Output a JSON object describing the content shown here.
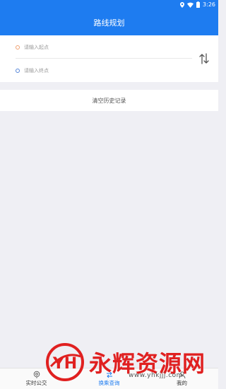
{
  "status_bar": {
    "time": "3:26"
  },
  "app_bar": {
    "title": "路线规划"
  },
  "route": {
    "start_placeholder": "请输入起点",
    "end_placeholder": "请输入终点",
    "start_value": "",
    "end_value": ""
  },
  "history": {
    "clear_label": "清空历史记录"
  },
  "bottom_nav": {
    "items": [
      {
        "label": "实时公交",
        "icon": "location-pin-icon"
      },
      {
        "label": "换乘查询",
        "icon": "transfer-icon"
      },
      {
        "label": "我的",
        "icon": "person-icon"
      }
    ],
    "active_index": 1
  },
  "watermark": {
    "logo_text": "YH",
    "text": "永辉资源网",
    "url": "www.yhkjjj.com"
  },
  "colors": {
    "primary": "#1e7cf0",
    "background": "#efeff4",
    "start_dot": "#f0a070",
    "end_dot": "#5585d9",
    "watermark": "#e02020"
  }
}
